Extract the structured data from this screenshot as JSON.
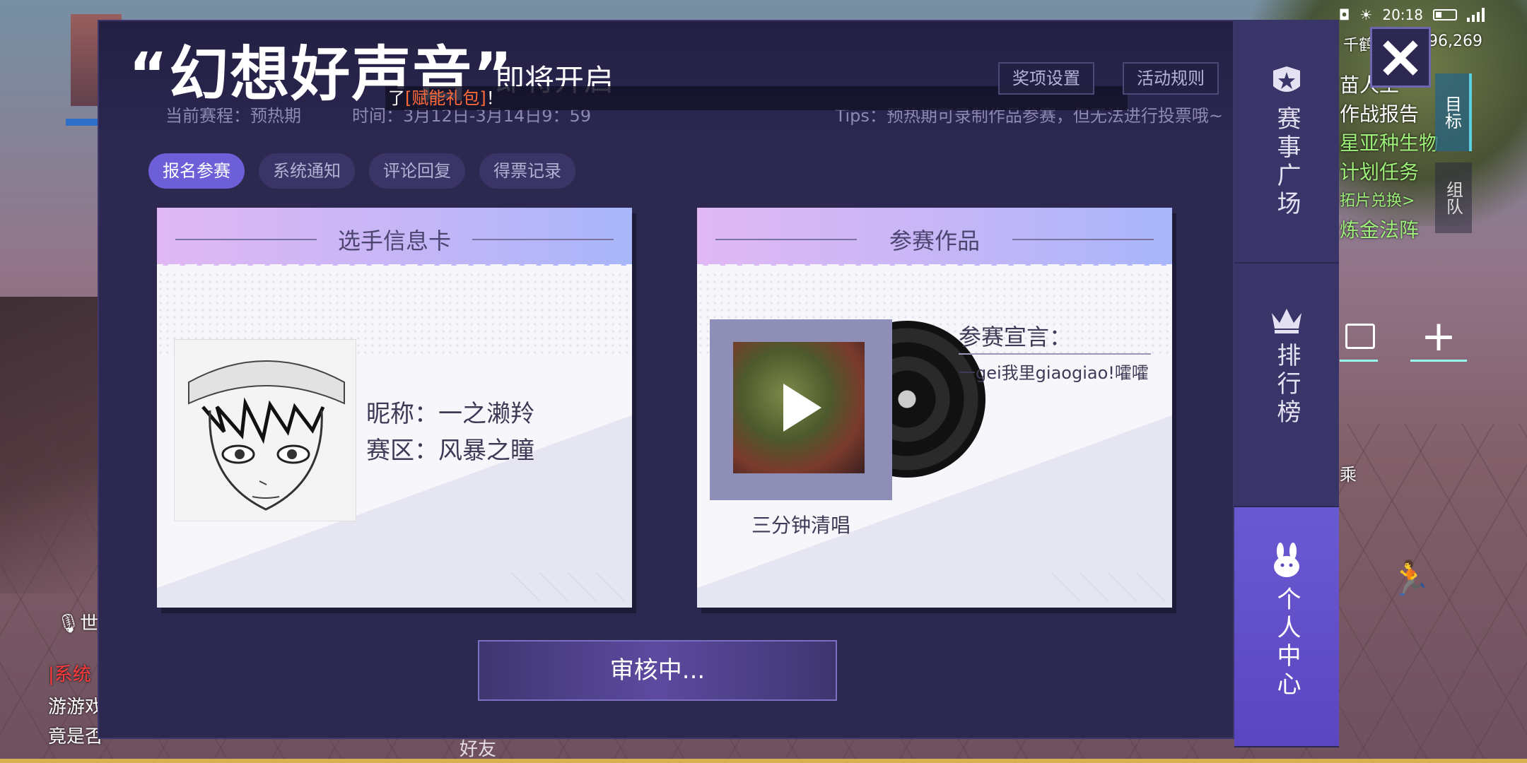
{
  "status_bar": {
    "time": "20:18"
  },
  "hud": {
    "player_name_fragment": "千鹤",
    "score": "96,269",
    "quest_lines": [
      "苗人工",
      "作战报告",
      "星亚种生物",
      "计划任务",
      "拓片兑换>",
      "炼金法阵"
    ],
    "target_label": "目标",
    "team_label": "组队",
    "ride_label": "乘",
    "voice_label": "世",
    "chat_lines": [
      "|系统",
      "游游戏",
      "竟是否"
    ],
    "friends_label": "好友"
  },
  "modal": {
    "title_quote": "“幻想好声音”",
    "title_sub": "即将开启",
    "phase": "当前赛程：预热期",
    "time": "时间：3月12日-3月14日9：59",
    "tips": "Tips：预热期可录制作品参赛，但无法进行投票哦~",
    "marquee_prefix": "了",
    "marquee_highlight": "[赋能礼包]",
    "marquee_suffix": "！",
    "award_button": "奖项设置",
    "rules_button": "活动规则",
    "tabs": [
      {
        "label": "报名参赛",
        "active": true
      },
      {
        "label": "系统通知",
        "active": false
      },
      {
        "label": "评论回复",
        "active": false
      },
      {
        "label": "得票记录",
        "active": false
      }
    ],
    "player_card": {
      "title": "选手信息卡",
      "nickname": "昵称：一之濑羚",
      "zone": "赛区：风暴之瞳"
    },
    "works_card": {
      "title": "参赛作品",
      "work_name": "三分钟清唱",
      "declaration_label": "参赛宣言：",
      "declaration": "一gei我里giaogiao!嚯嚯"
    },
    "review_button": "审核中..."
  },
  "side_nav": [
    {
      "label": "赛事广场",
      "icon": "star-icon"
    },
    {
      "label": "排行榜",
      "icon": "crown-icon"
    },
    {
      "label": "个人中心",
      "icon": "rabbit-icon",
      "active": true
    }
  ],
  "colors": {
    "modal_bg": "#2d2850",
    "accent": "#6d5fd8",
    "highlight": "#ff6a3a",
    "card_bg": "#f6f6fb"
  }
}
